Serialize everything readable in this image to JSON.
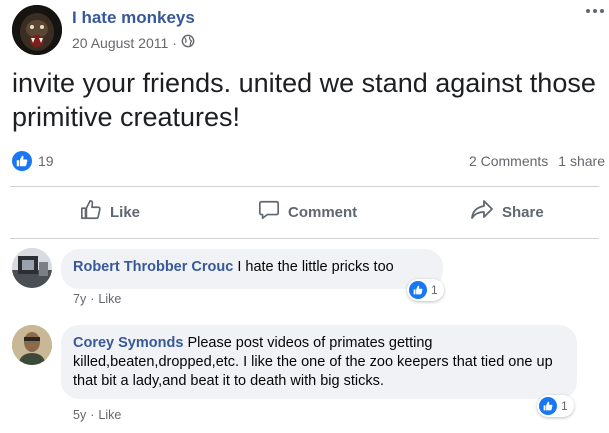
{
  "post": {
    "page_name": "I hate monkeys",
    "date": "20 August 2011",
    "separator": "·",
    "audience_icon": "globe-icon",
    "text": "invite your friends. united we stand against those primitive creatures!",
    "reactions_count": "19",
    "comments_count": "2 Comments",
    "shares_count": "1 share"
  },
  "actions": {
    "like": "Like",
    "comment": "Comment",
    "share": "Share"
  },
  "comments": [
    {
      "author": "Robert Throbber Crouc",
      "text": "I hate the little pricks too",
      "age": "7y",
      "separator": "·",
      "like_label": "Like",
      "reactions": "1"
    },
    {
      "author": "Corey Symonds",
      "text": "Please post videos of primates getting killed,beaten,dropped,etc. I like the one of the zoo keepers that tied one up that bit a lady,and beat it to death with big sticks.",
      "age": "5y",
      "separator": "·",
      "like_label": "Like",
      "reactions": "1"
    }
  ],
  "colors": {
    "brand_blue": "#385898",
    "like_blue": "#1877f2",
    "meta_gray": "#65676b",
    "bubble_bg": "#f0f2f5"
  }
}
